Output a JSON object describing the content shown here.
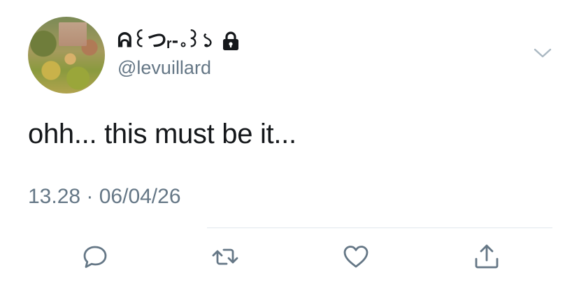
{
  "tweet": {
    "display_name": "ᕱ꒰つᵣ-｡꒱১",
    "handle": "@levuillard",
    "text": "ohh... this must be it...",
    "timestamp": "13.28 · 06/04/26",
    "protected": true
  },
  "icons": {
    "avatar": "profile-picture",
    "lock": "lock-icon",
    "chevron": "chevron-down-icon",
    "reply": "reply-icon",
    "retweet": "retweet-icon",
    "like": "heart-icon",
    "share": "share-icon"
  },
  "colors": {
    "text": "#14171a",
    "secondary": "#657786",
    "icon": "#657786",
    "divider": "#e1e8ed"
  }
}
